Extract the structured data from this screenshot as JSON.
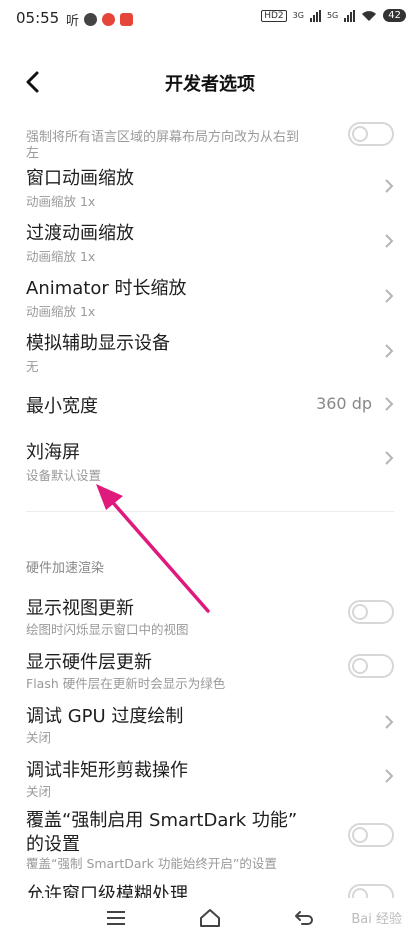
{
  "status_bar": {
    "time": "05:55",
    "left_text": "听",
    "hd": "HD2",
    "sig1": "3G",
    "sig2": "5G",
    "battery": "42"
  },
  "header": {
    "title": "开发者选项"
  },
  "partial_top": {
    "line1": "强制将所有语言区域的屏幕布局方向改为从右到",
    "line2": "左"
  },
  "items": [
    {
      "title": "窗口动画缩放",
      "subtitle": "动画缩放 1x"
    },
    {
      "title": "过渡动画缩放",
      "subtitle": "动画缩放 1x"
    },
    {
      "title": "Animator 时长缩放",
      "subtitle": "动画缩放 1x"
    },
    {
      "title": "模拟辅助显示设备",
      "subtitle": "无"
    },
    {
      "title": "最小宽度",
      "value": "360 dp"
    },
    {
      "title": "刘海屏",
      "subtitle": "设备默认设置"
    }
  ],
  "section_header": "硬件加速渲染",
  "hw_items": [
    {
      "title": "显示视图更新",
      "subtitle": "绘图时闪烁显示窗口中的视图"
    },
    {
      "title": "显示硬件层更新",
      "subtitle": "Flash 硬件层在更新时会显示为绿色"
    },
    {
      "title": "调试 GPU 过度绘制",
      "subtitle": "关闭"
    },
    {
      "title": "调试非矩形剪裁操作",
      "subtitle": "关闭"
    },
    {
      "title_line1": "覆盖“强制启用 SmartDark 功能”",
      "title_line2": "的设置",
      "subtitle": "覆盖“强制 SmartDark 功能始终开启”的设置"
    },
    {
      "title": "允许窗口级模糊处理"
    }
  ],
  "watermark": "Bai 经验",
  "colors": {
    "annotation_arrow": "#e0197d",
    "toggle_border": "#d7d7d7"
  }
}
